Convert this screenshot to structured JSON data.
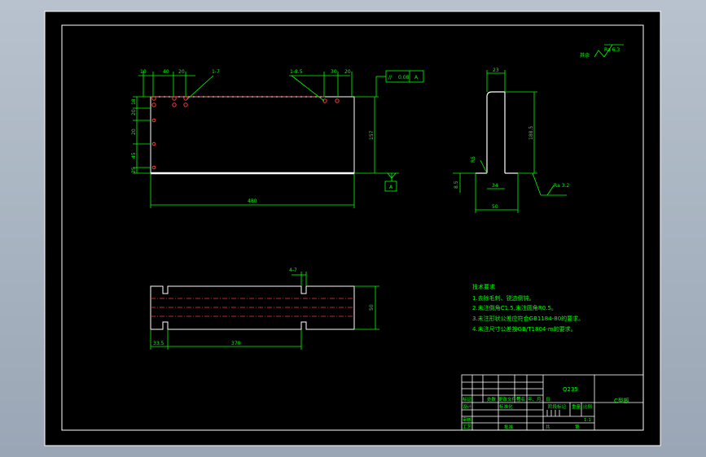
{
  "colors": {
    "paper": "#000000",
    "frame": "#ffffff",
    "outline": "#ffffff",
    "dim": "#00ff00",
    "hole": "#ff3b3b",
    "centerline": "#ff3b3b",
    "text": "#00ff00",
    "window_bg": "#a9b4c2"
  },
  "plan_view": {
    "top_dims": [
      "10",
      "40",
      "20",
      "1-7",
      "1-8.5",
      "30",
      "20"
    ],
    "left_dims": [
      "18",
      "20",
      "20",
      "45",
      "25"
    ],
    "height_dim": "157",
    "length_dim": "480",
    "flatness": {
      "symbol": "//",
      "value": "0.08",
      "datum": "A"
    },
    "datum_bottom": "A"
  },
  "side_view": {
    "width_top": "23",
    "height": "188.5",
    "chamfer": "R5",
    "base_width": "34",
    "base_height": "8.5",
    "overall_width": "50",
    "roughness_label": "Ra 3.2"
  },
  "roughness_corner": {
    "prefix": "其余",
    "value": "Ra 6.3"
  },
  "front_view": {
    "slot_label": "4-7",
    "height_dim": "50",
    "left_dim": "33.5",
    "span_dim": "370"
  },
  "tech_req": {
    "title": "技术要求",
    "lines": [
      "1.去除毛刺、锐边倒钝。",
      "2.未注倒角C1.5,未注圆角R0.5。",
      "3.未注形状公差应符合GB1184-80的要求。",
      "4.未注尺寸公差按GB/T1804-m的要求。"
    ]
  },
  "title_block": {
    "material": "Q235",
    "part_name": "C型板",
    "row_labels": [
      "标记",
      "处数",
      "分区",
      "更改文件号",
      "签名",
      "年、月、日"
    ],
    "designer_label": "设计",
    "std_label": "标准化",
    "review_label": "审核",
    "process_label": "工艺",
    "approve_label": "批准",
    "stage_label": "阶段标记",
    "weight_label": "重量",
    "scale_label": "比例",
    "scale_value": "1:1",
    "sheet_label": "共",
    "sheet_of": "第"
  }
}
